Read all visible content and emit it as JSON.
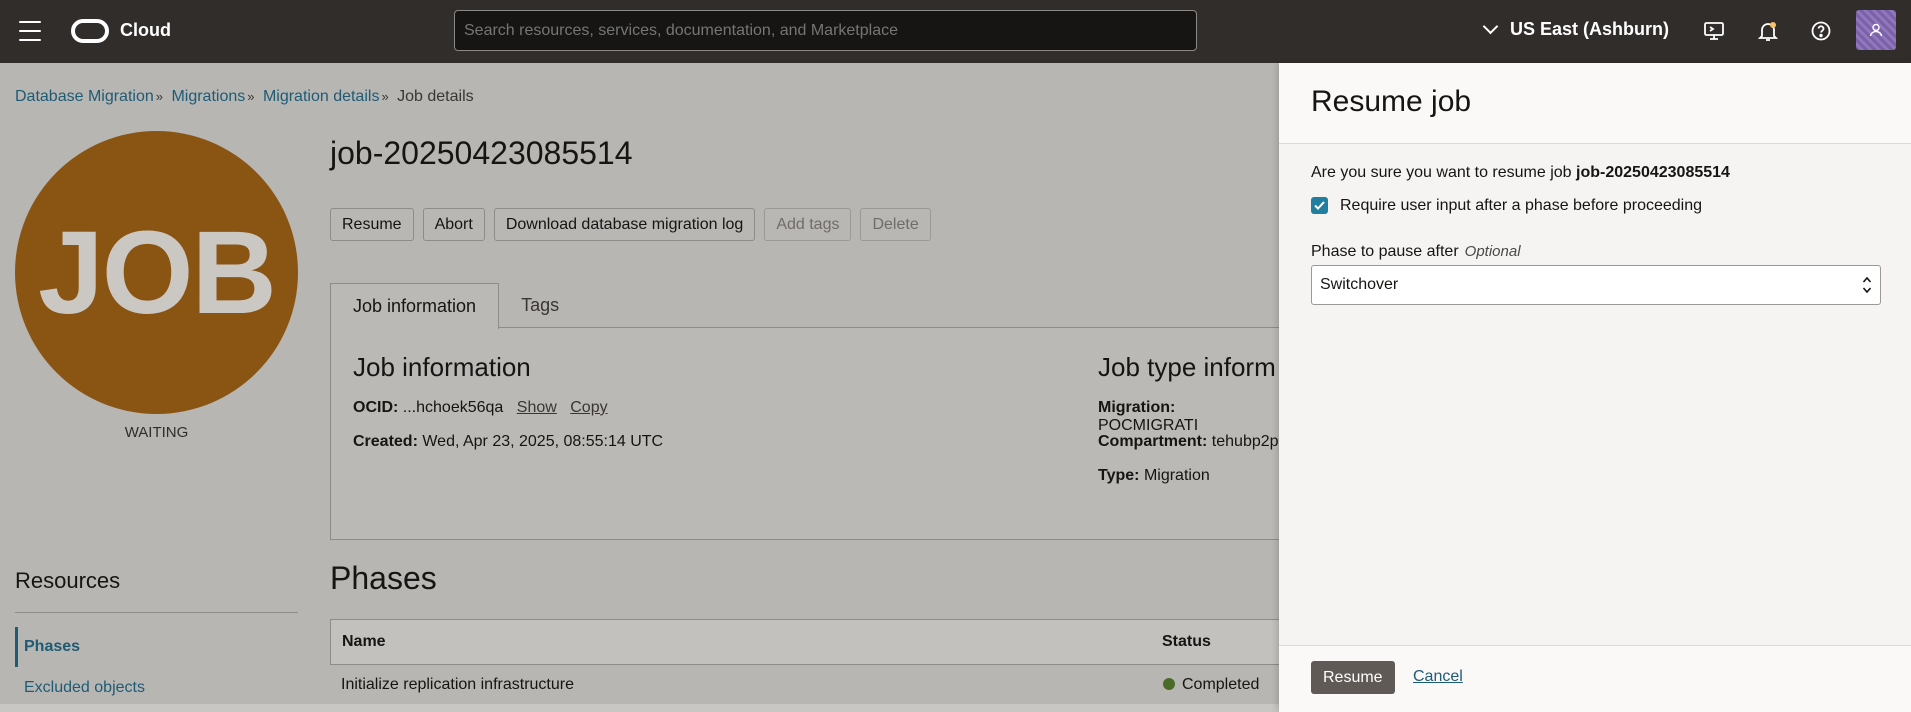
{
  "topbar": {
    "brand": "Cloud",
    "search_placeholder": "Search resources, services, documentation, and Marketplace",
    "region": "US East (Ashburn)",
    "icons": [
      "menu-icon",
      "cloud-logo-icon",
      "chevron-down-icon",
      "cloud-shell-icon",
      "bell-icon",
      "help-icon",
      "user-icon"
    ]
  },
  "breadcrumb": {
    "items": [
      "Database Migration",
      "Migrations",
      "Migration details"
    ],
    "current": "Job details",
    "separator": "»"
  },
  "job": {
    "badge": "JOB",
    "state": "WAITING",
    "title": "job-20250423085514",
    "badge_color": "#8a5512"
  },
  "actions": {
    "resume": "Resume",
    "abort": "Abort",
    "download_log": "Download database migration log",
    "add_tags": "Add tags",
    "delete": "Delete"
  },
  "tabs": {
    "job_information": "Job information",
    "tags": "Tags"
  },
  "job_information": {
    "heading": "Job information",
    "ocid_label": "OCID:",
    "ocid_value": "...hchoek56qa",
    "show": "Show",
    "copy": "Copy",
    "created_label": "Created:",
    "created_value": "Wed, Apr 23, 2025, 08:55:14 UTC"
  },
  "job_type": {
    "heading": "Job type inform",
    "migration_label": "Migration:",
    "migration_value": "POCMIGRATI",
    "compartment_label": "Compartment:",
    "compartment_value": "tehubp2p",
    "type_label": "Type:",
    "type_value": "Migration"
  },
  "resources": {
    "title": "Resources",
    "items": [
      "Phases",
      "Excluded objects"
    ]
  },
  "phases": {
    "title": "Phases",
    "columns": [
      "Name",
      "Status"
    ],
    "rows": [
      {
        "name": "Initialize replication infrastructure",
        "status": "Completed"
      }
    ],
    "status_color": "#4a6b2a"
  },
  "drawer": {
    "title": "Resume job",
    "confirm_text": "Are you sure you want to resume job",
    "confirm_job": "job-20250423085514",
    "checkbox_label": "Require user input after a phase before proceeding",
    "checkbox_checked": true,
    "field_label": "Phase to pause after",
    "field_optional": "Optional",
    "select_value": "Switchover",
    "primary_button": "Resume",
    "cancel_link": "Cancel",
    "accent_color": "#227e9e"
  }
}
